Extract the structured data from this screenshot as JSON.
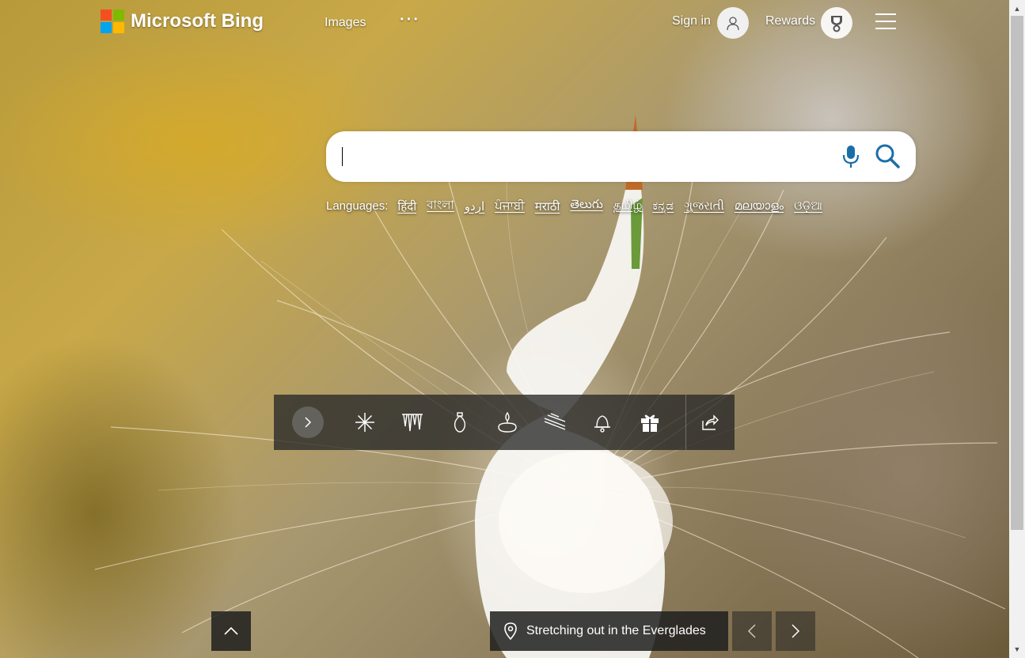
{
  "header": {
    "brand": "Microsoft Bing",
    "nav_images": "Images",
    "nav_more": "···",
    "signin": "Sign in",
    "rewards": "Rewards"
  },
  "search": {
    "value": "",
    "placeholder": ""
  },
  "languages": {
    "label": "Languages:",
    "items": [
      "हिंदी",
      "বাংলা",
      "اردو",
      "ਪੰਜਾਬੀ",
      "मराठी",
      "తెలుగు",
      "தமிழ்",
      "ಕನ್ನಡ",
      "ગુજરાતી",
      "മലയാളം",
      "ଓଡ଼ିଆ"
    ]
  },
  "toolbar": {
    "icons": [
      "snowflake-icon",
      "icicles-icon",
      "ornament-icon",
      "candle-icon",
      "streamer-icon",
      "bell-icon",
      "gift-icon",
      "share-icon"
    ]
  },
  "image_caption": {
    "title": "Stretching out in the Everglades"
  },
  "colors": {
    "ms_red": "#f25022",
    "ms_green": "#7fba00",
    "ms_blue": "#00a4ef",
    "ms_yellow": "#ffb900",
    "search_accent": "#1a6ea8"
  }
}
